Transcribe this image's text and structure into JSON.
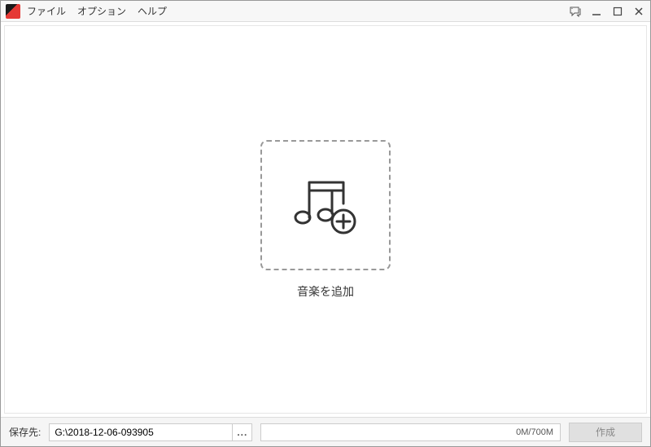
{
  "menu": {
    "file": "ファイル",
    "options": "オプション",
    "help": "ヘルプ"
  },
  "main": {
    "add_music_label": "音楽を追加"
  },
  "footer": {
    "save_label": "保存先:",
    "path_value": "G:\\2018-12-06-093905",
    "browse_label": "...",
    "progress_text": "0M/700M",
    "create_label": "作成"
  }
}
